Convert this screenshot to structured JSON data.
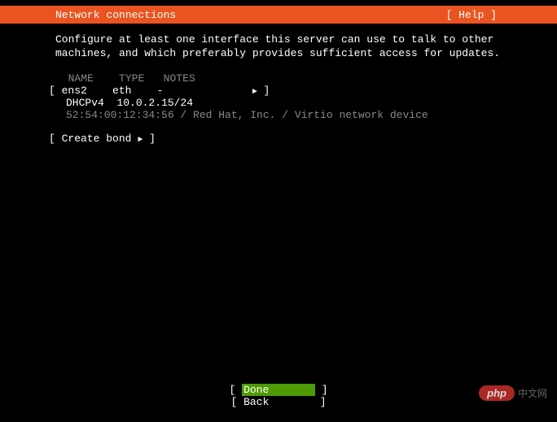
{
  "header": {
    "title": "Network connections",
    "help": "[ Help ]"
  },
  "instructions": "Configure at least one interface this server can use to talk to other machines, and which preferably provides sufficient access for updates.",
  "table": {
    "headers": {
      "name": "NAME",
      "type": "TYPE",
      "notes": "NOTES"
    },
    "interface": {
      "name": "ens2",
      "type": "eth",
      "notes": "-",
      "arrow": "►",
      "method": "DHCPv4",
      "address": "10.0.2.15/24",
      "mac": "52:54:00:12:34:56 / Red Hat, Inc. / Virtio network device"
    }
  },
  "actions": {
    "create_bond": "Create bond",
    "create_bond_arrow": "►"
  },
  "buttons": {
    "done": "Done",
    "back": "Back"
  },
  "watermark": {
    "logo": "php",
    "text": "中文网"
  }
}
